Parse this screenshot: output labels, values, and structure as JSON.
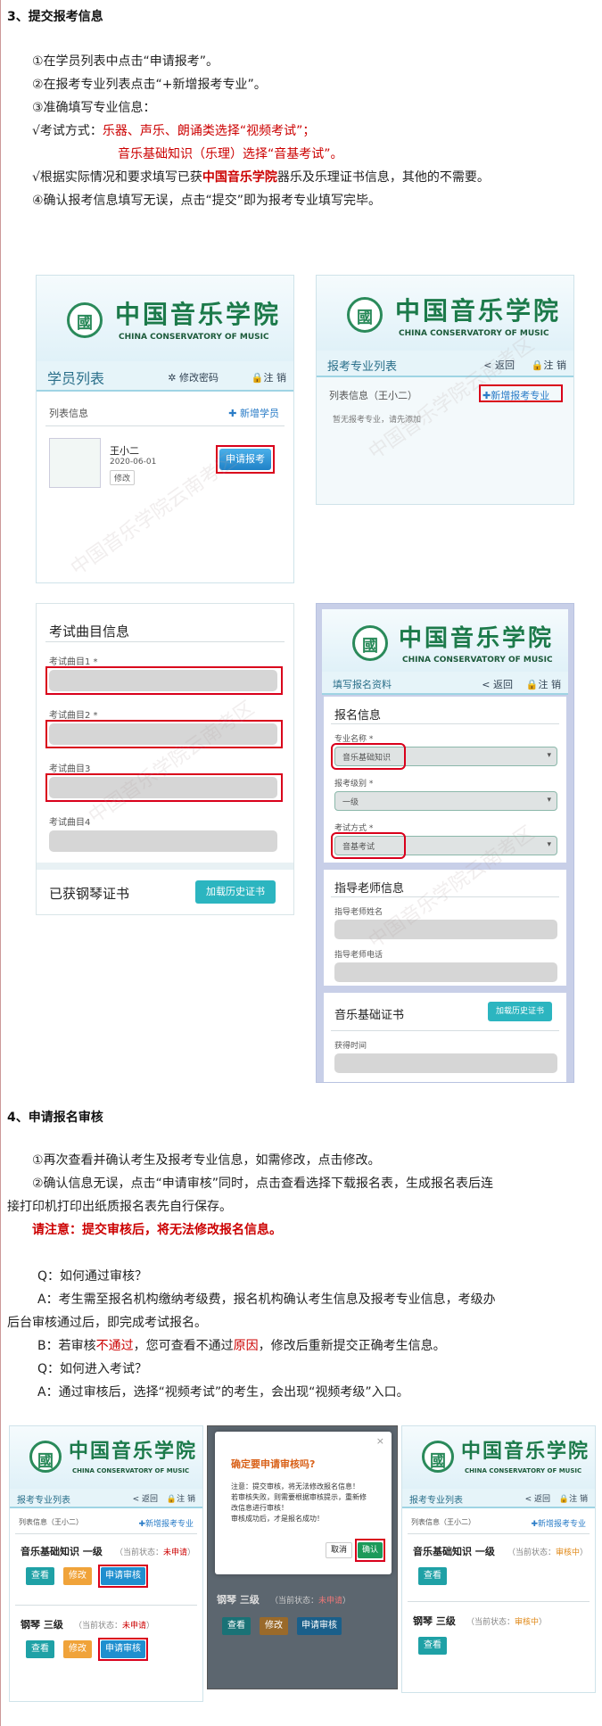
{
  "section3": {
    "title": "3、提交报考信息",
    "step1": "①在学员列表中点击“申请报考”。",
    "step2": "②在报考专业列表点击“+新增报考专业”。",
    "step3": "③准确填写专业信息：",
    "exam_mode_prefix": "√考试方式：",
    "exam_mode_red1": "乐器、声乐、朗诵类选择“视频考试”；",
    "exam_mode_red2": "音乐基础知识（乐理）选择“音基考试”。",
    "cert_prefix": "√根据实际情况和要求填写已获",
    "cert_red": "中国音乐学院",
    "cert_suffix": "器乐及乐理证书信息，其他的不需要。",
    "step4": "④确认报考信息填写无误，点击“提交”即为报考专业填写完毕。"
  },
  "logo": {
    "cn": "中国音乐学院",
    "en": "CHINA CONSERVATORY OF MUSIC"
  },
  "shot1": {
    "nav_title": "学员列表",
    "change_pwd": "修改密码",
    "logout": "注 销",
    "list_info": "列表信息",
    "add_student": "新增学员",
    "student_name": "王小二",
    "student_date": "2020-06-01",
    "edit": "修改",
    "apply_btn": "申请报考"
  },
  "shot2": {
    "nav_title": "报考专业列表",
    "back": "< 返回",
    "logout": "注 销",
    "list_info": "列表信息（王小二）",
    "add_major": "新增报考专业",
    "empty": "暂无报考专业，请先添加"
  },
  "shot3": {
    "title": "考试曲目信息",
    "piece1": "考试曲目1 *",
    "piece2": "考试曲目2 *",
    "piece3": "考试曲目3",
    "piece4": "考试曲目4",
    "cert_title": "已获钢琴证书",
    "load_btn": "加载历史证书"
  },
  "shot4": {
    "nav_title": "填写报名资料",
    "back": "< 返回",
    "logout": "注 销",
    "reg_title": "报名信息",
    "major_label": "专业名称 *",
    "major_value": "音乐基础知识",
    "level_label": "报考级别 *",
    "level_value": "一级",
    "mode_label": "考试方式 *",
    "mode_value": "音基考试",
    "teacher_title": "指导老师信息",
    "teacher_name": "指导老师姓名",
    "teacher_phone": "指导老师电话",
    "cert_title": "音乐基础证书",
    "load_btn": "加载历史证书",
    "obtained_time": "获得时间"
  },
  "section4": {
    "title": "4、申请报名审核",
    "p1": "①再次查看并确认考生及报考专业信息，如需修改，点击修改。",
    "p2a": "②确认信息无误，点击“申请审核”同时，点击查看选择下载报名表，生成报名表后连",
    "p2b": "接打印机打印出纸质报名表先自行保存。",
    "notice": "请注意：提交审核后，将无法修改报名信息。",
    "q1": "Q：如何通过审核？",
    "a1a": "A：考生需至报名机构缴纳考级费，报名机构确认考生信息及报考专业信息，考级办",
    "a1b": "后台审核通过后，即完成考试报名。",
    "b1_prefix": "B：若审核",
    "b1_red": "不通过",
    "b1_mid": "，您可查看不通过",
    "b1_red2": "原因",
    "b1_suffix": "，修改后重新提交正确考生信息。",
    "q2": "Q：如何进入考试？",
    "a2": "A：通过审核后，选择“视频考试”的考生，会出现“视频考级”入口。"
  },
  "shot5": {
    "nav_title": "报考专业列表",
    "back": "< 返回",
    "logout": "注 销",
    "list_info": "列表信息（王小二）",
    "add_major": "新增报考专业",
    "card1_title": "音乐基础知识  一级",
    "card1_status": "（当前状态：",
    "card1_state": "未申请",
    "card2_title": "钢琴  三级",
    "card2_status": "（当前状态：",
    "card2_state": "未申请",
    "view": "查看",
    "edit": "修改",
    "apply": "申请审核"
  },
  "shot6": {
    "dialog_title": "确定要申请审核吗?",
    "dialog_body1": "注意：提交审核，将无法修改报名信息！",
    "dialog_body2": "若审核失败，则需要根据审核提示，重新修",
    "dialog_body3": "改信息进行审核！",
    "dialog_body4": "审核成功后，才是报名成功！",
    "cancel": "取消",
    "confirm": "确认",
    "card2_title": "钢琴  三级",
    "card2_status": "（当前状态：",
    "card2_state": "未申请",
    "view": "查看",
    "edit": "修改",
    "apply": "申请审核"
  },
  "shot7": {
    "nav_title": "报考专业列表",
    "back": "< 返回",
    "logout": "注 销",
    "list_info": "列表信息（王小二）",
    "add_major": "新增报考专业",
    "card1_title": "音乐基础知识  一级",
    "card1_status": "（当前状态：",
    "card1_state": "审核中",
    "card2_title": "钢琴  三级",
    "card2_status": "（当前状态：",
    "card2_state": "审核中",
    "view": "查看"
  },
  "watermark": "中国音乐学院云南考区",
  "colors": {
    "accent": "#2cb5c0",
    "red": "#cc0000",
    "green": "#1c7a4a",
    "link": "#2a7cc7"
  }
}
